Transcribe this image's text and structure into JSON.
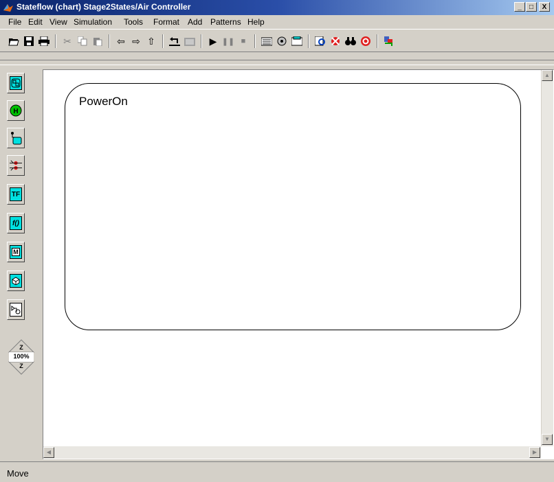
{
  "window": {
    "title": "Stateflow (chart) Stage2States/Air Controller",
    "minimize_label": "_",
    "maximize_label": "□",
    "close_label": "X"
  },
  "menu": {
    "items": [
      "File",
      "Edit",
      "View",
      "Simulation",
      "Tools",
      "Format",
      "Add",
      "Patterns",
      "Help"
    ]
  },
  "toolbar": {
    "icons": [
      "open-folder",
      "save",
      "print",
      "cut",
      "copy",
      "paste",
      "back-arrow",
      "forward-arrow",
      "up-arrow",
      "undo",
      "redo",
      "start",
      "pause",
      "stop",
      "build",
      "build-all",
      "model-explorer",
      "debug",
      "find",
      "explore",
      "target",
      "simulink"
    ]
  },
  "palette": {
    "tools": [
      "state",
      "history-junction",
      "default-transition",
      "connective-junction",
      "truth-table",
      "graphical-function",
      "embedded-matlab",
      "box",
      "simulink-function"
    ],
    "labels": {
      "truth_table": "TF",
      "graphical_function": "f()",
      "embedded_matlab": "M",
      "history_junction": "H"
    },
    "zoom": {
      "in_label": "Z",
      "level": "100%",
      "out_label": "Z"
    }
  },
  "canvas": {
    "states": [
      {
        "label": "PowerOn"
      }
    ]
  },
  "status": {
    "text": "Move"
  },
  "colors": {
    "title_start": "#0a246a",
    "title_end": "#a6caf0",
    "palette_cyan": "#00e0e0",
    "chrome": "#d4d0c8"
  }
}
